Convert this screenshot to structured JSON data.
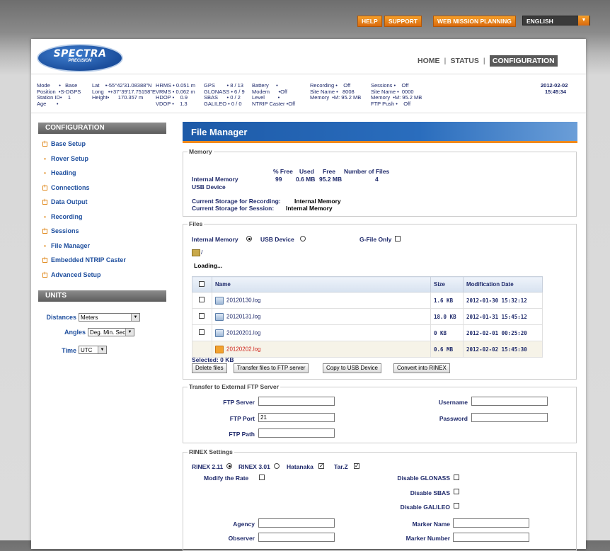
{
  "topbar": {
    "help": "HELP",
    "support": "SUPPORT",
    "mission": "WEB MISSION PLANNING",
    "language": "ENGLISH"
  },
  "logo": {
    "brand": "SPECTRA",
    "sub": "PRECISION"
  },
  "mainnav": {
    "home": "HOME",
    "status": "STATUS",
    "configuration": "CONFIGURATION"
  },
  "status": {
    "c1": "Mode      •   Base\nPosition  •S-DGPS\nStation ID•    1\nAge       •",
    "c2": "Lat    •-55°42'31.08388\"N\nLong   •+37°39'17.75158\"E\nHeight•      170.357 m",
    "c3": "HRMS • 0.051 m\nVRMS • 0.062 m\nHDOP •    0.9\nVDOP •    1.3",
    "c4": "GPS        • 8 / 13\nGLONASS • 6 / 9\nSBAS      • 0 / 2\nGALILEO • 0 / 0",
    "c5": "Battery     •\nModem      •Off\nLevel         •\nNTRIP Caster •Off",
    "c6": "Recording •    Off\nSite Name •   8008\nMemory  •M: 95.2 MB",
    "c7": "Sessions •    Off\nSite Name •  0000\nMemory  •M: 95.2 MB\nFTP Push •    Off",
    "date": "2012-02-02",
    "time": "15:45:34"
  },
  "sidebar": {
    "config_title": "CONFIGURATION",
    "items": [
      {
        "label": "Base Setup",
        "type": "box"
      },
      {
        "label": "Rover Setup",
        "type": "dot"
      },
      {
        "label": "Heading",
        "type": "dot"
      },
      {
        "label": "Connections",
        "type": "box"
      },
      {
        "label": "Data Output",
        "type": "box"
      },
      {
        "label": "Recording",
        "type": "dot"
      },
      {
        "label": "Sessions",
        "type": "box"
      },
      {
        "label": "File Manager",
        "type": "dot"
      },
      {
        "label": "Embedded NTRIP Caster",
        "type": "box"
      },
      {
        "label": "Advanced Setup",
        "type": "box"
      }
    ],
    "units_title": "UNITS",
    "units": {
      "distances_label": "Distances",
      "distances_value": "Meters",
      "angles_label": "Angles",
      "angles_value": "Deg. Min. Sec.",
      "time_label": "Time",
      "time_value": "UTC"
    }
  },
  "content": {
    "title": "File Manager",
    "memory": {
      "legend": "Memory",
      "col_free_pct": "% Free",
      "col_used": "Used",
      "col_free": "Free",
      "col_files": "Number of Files",
      "internal_label": "Internal Memory",
      "internal_free_pct": "99",
      "internal_used": "0.6 MB",
      "internal_free": "95.2 MB",
      "internal_files": "4",
      "usb_label": "USB Device",
      "rec_storage_label": "Current Storage for Recording:",
      "rec_storage_value": "Internal Memory",
      "ses_storage_label": "Current Storage for Session:",
      "ses_storage_value": "Internal Memory"
    },
    "files": {
      "legend": "Files",
      "internal_radio": "Internal Memory",
      "usb_radio": "USB Device",
      "gfile_label": "G-File Only",
      "path": "/",
      "loading": "Loading...",
      "col_name": "Name",
      "col_size": "Size",
      "col_date": "Modification Date",
      "rows": [
        {
          "name": "20120130.log",
          "size": "1.6 KB",
          "date": "2012-01-30 15:32:12"
        },
        {
          "name": "20120131.log",
          "size": "18.0 KB",
          "date": "2012-01-31 15:45:12"
        },
        {
          "name": "20120201.log",
          "size": "0 KB",
          "date": "2012-02-01 00:25:20"
        },
        {
          "name": "20120202.log",
          "size": "0.6 MB",
          "date": "2012-02-02 15:45:30"
        }
      ],
      "selected": "Selected: 0 KB",
      "btn_delete": "Delete files",
      "btn_ftp": "Transfer files to FTP server",
      "btn_usb": "Copy to USB Device",
      "btn_rinex": "Convert into RINEX"
    },
    "ftp": {
      "legend": "Transfer to External FTP Server",
      "server_label": "FTP Server",
      "port_label": "FTP Port",
      "port_value": "21",
      "path_label": "FTP Path",
      "username_label": "Username",
      "password_label": "Password"
    },
    "rinex": {
      "legend": "RINEX Settings",
      "v211": "RINEX 2.11",
      "v301": "RINEX 3.01",
      "hatanaka": "Hatanaka",
      "tarz": "Tar.Z",
      "modify_rate": "Modify the Rate",
      "disable_glonass": "Disable GLONASS",
      "disable_sbas": "Disable SBAS",
      "disable_galileo": "Disable GALILEO",
      "agency": "Agency",
      "observer": "Observer",
      "marker_name": "Marker Name",
      "marker_number": "Marker Number"
    }
  }
}
